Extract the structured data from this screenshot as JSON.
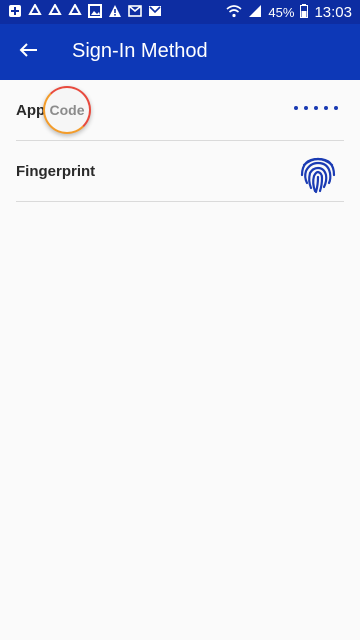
{
  "status_bar": {
    "battery": "45%",
    "time": "13:03",
    "icons": [
      "add-square-icon",
      "recycle-icon",
      "recycle-icon",
      "recycle-icon",
      "image-icon",
      "warning-icon",
      "mail-image-icon",
      "gmail-icon",
      "wifi-icon",
      "signal-icon",
      "battery-icon"
    ]
  },
  "app_bar": {
    "title": "Sign-In Method",
    "back_icon": "arrow-left-icon"
  },
  "options": [
    {
      "label": "App Code",
      "indicator": "dots"
    },
    {
      "label": "Fingerprint",
      "indicator": "fingerprint-icon"
    }
  ],
  "touch_text": "Code",
  "colors": {
    "status_bar": "#0d2da2",
    "app_bar": "#0d38b7",
    "accent": "#1a3bb3"
  }
}
